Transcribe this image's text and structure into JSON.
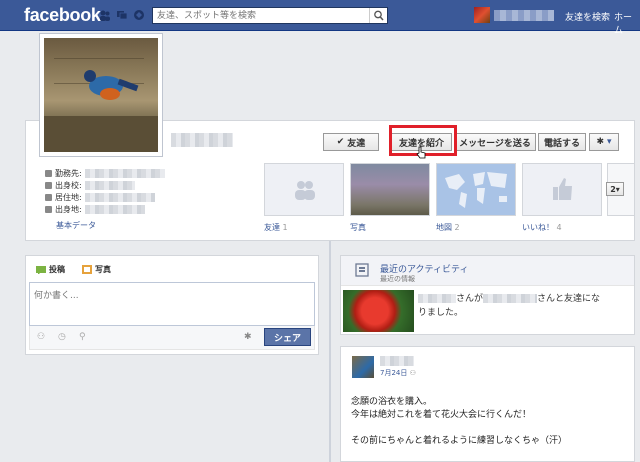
{
  "header": {
    "logo": "facebook",
    "search_placeholder": "友達、スポット等を検索",
    "find_friends": "友達を検索",
    "home": "ホーム"
  },
  "profile": {
    "actions": {
      "friend": "友達",
      "suggest_friends": "友達を紹介",
      "send_message": "メッセージを送る",
      "call": "電話する"
    },
    "info_labels": {
      "work": "勤務先:",
      "hometown_school": "出身校:",
      "residence": "居住地:",
      "hometown": "出身地:"
    },
    "basic_data": "基本データ",
    "tiles": {
      "friends": "友達",
      "friends_count": "1",
      "photos": "写真",
      "map": "地図",
      "map_count": "2",
      "likes": "いいね！",
      "likes_count": "4",
      "more_count": "2"
    }
  },
  "composer": {
    "tab_post": "投稿",
    "tab_photo": "写真",
    "placeholder": "何か書く...",
    "share": "シェア"
  },
  "activity": {
    "title": "最近のアクティビティ",
    "subtitle": "最近の情報",
    "text_a": "さんが",
    "text_b": "さんと友達にな",
    "text_c": "りました。"
  },
  "post": {
    "date": "7月24日",
    "line1": "念願の浴衣を購入。",
    "line2": "今年は絶対これを着て花火大会に行くんだ！",
    "line3": "その前にちゃんと着れるように練習しなくちゃ（汗）"
  },
  "colors": {
    "brand": "#3b5998",
    "highlight": "#e0202a",
    "share_button": "#5b74a8"
  }
}
